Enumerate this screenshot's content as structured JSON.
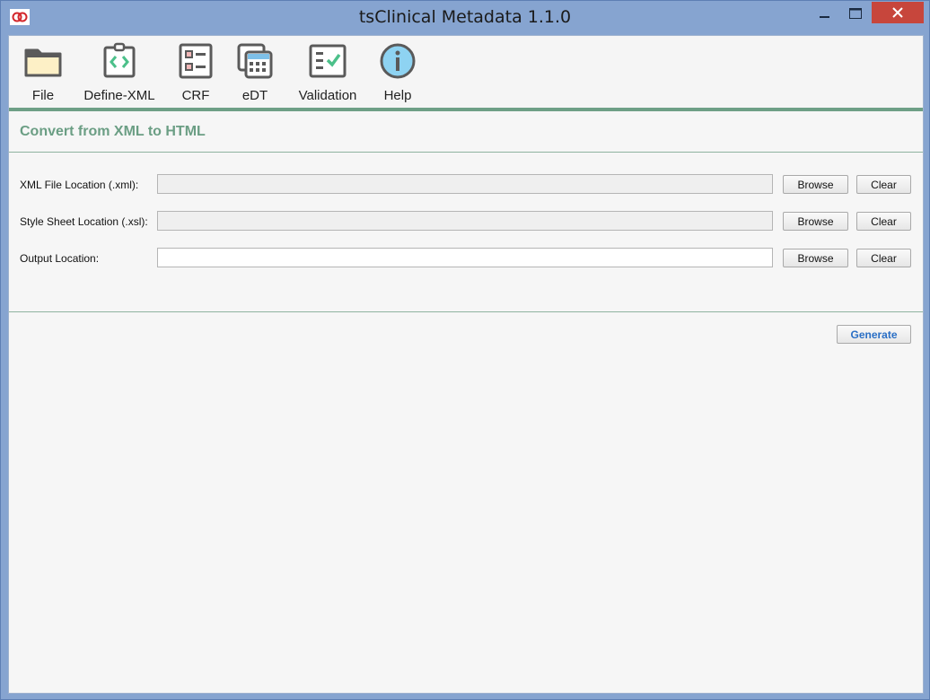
{
  "window": {
    "title": "tsClinical Metadata 1.1.0",
    "controls": {
      "minimize": "—",
      "maximize": "□",
      "close": "✕"
    }
  },
  "toolbar": {
    "items": [
      {
        "label": "File",
        "icon": "folder-icon"
      },
      {
        "label": "Define-XML",
        "icon": "define-xml-icon"
      },
      {
        "label": "CRF",
        "icon": "crf-icon"
      },
      {
        "label": "eDT",
        "icon": "edt-icon"
      },
      {
        "label": "Validation",
        "icon": "validation-icon"
      },
      {
        "label": "Help",
        "icon": "help-info-icon"
      }
    ],
    "accent_color": "#6e9f86"
  },
  "main": {
    "section_title": "Convert from XML to HTML",
    "fields": [
      {
        "label": "XML File Location (.xml):",
        "value": "",
        "browse": "Browse",
        "clear": "Clear"
      },
      {
        "label": "Style Sheet Location (.xsl):",
        "value": "",
        "browse": "Browse",
        "clear": "Clear"
      },
      {
        "label": "Output Location:",
        "value": "",
        "browse": "Browse",
        "clear": "Clear"
      }
    ],
    "generate_label": "Generate"
  }
}
